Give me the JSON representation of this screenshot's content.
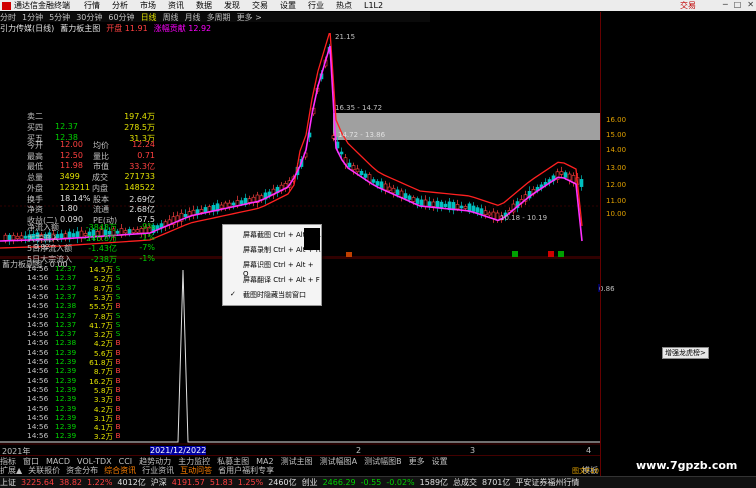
{
  "app": {
    "title": "通达信金融终端",
    "right_link": "交易"
  },
  "menu": [
    "行情",
    "分析",
    "市场",
    "资讯",
    "数据",
    "发现",
    "交易",
    "设置",
    "行业",
    "热点",
    "L1L2"
  ],
  "periods": [
    "分时",
    "1分钟",
    "5分钟",
    "30分钟",
    "60分钟",
    "日线",
    "周线",
    "月线",
    "多周期",
    "更多 >"
  ],
  "active_period": "日线",
  "info": {
    "indicator": "引力传媒(日线)",
    "label2": "蓄力板主图",
    "val1": "开盘 11.91",
    "val2": "涨幅贡献 12.92"
  },
  "chart_labels": {
    "hi": "21.15",
    "box1": "16.35 - 14.72",
    "box2": "14.72 - 13.86",
    "lo": "10.18 - 10.19",
    "left_lo": "9.02"
  },
  "price_axis": [
    "16.00",
    "15.00",
    "14.00",
    "13.00",
    "12.00",
    "11.00",
    "10.00"
  ],
  "sub_label": "蓄力板副图 : 0.00",
  "sub_value": "0.86",
  "date_axis": {
    "left": "2021年",
    "mid": "2021/12/2022",
    "m2": "2",
    "m3": "3",
    "m4": "4"
  },
  "context_menu": [
    {
      "label": "屏幕截图 Ctrl + Alt + A",
      "checked": false
    },
    {
      "label": "屏幕录制 Ctrl + Alt + R",
      "checked": false
    },
    {
      "label": "屏幕识图 Ctrl + Alt + O",
      "checked": false
    },
    {
      "label": "屏幕翻译 Ctrl + Alt + F",
      "checked": false
    },
    {
      "label": "截图时隐藏当前窗口",
      "checked": true
    }
  ],
  "toolbar": [
    "指标",
    "窗口",
    "MACD",
    "VOL-TDX",
    "CCI",
    "趋势动力",
    "主力监控",
    "私募主图",
    "MA2",
    "测试主图",
    "测试幅图A",
    "测试幅图B",
    "更多",
    "设置"
  ],
  "toolbar2": [
    "扩展▲",
    "关联报价",
    "资金分布",
    "综合资讯",
    "行业资讯",
    "互动问答",
    "省用户福利专享"
  ],
  "toolbar2_right": "模板",
  "quotes": [
    {
      "label": "卖二",
      "price": "",
      "vol": "197.4万",
      "pc": "wh"
    },
    {
      "label": "买四",
      "price": "12.37",
      "vol": "278.5万",
      "pc": "dn"
    },
    {
      "label": "买五",
      "price": "12.38",
      "vol": "31.3万",
      "pc": "dn"
    }
  ],
  "stats": [
    {
      "a": "今开",
      "b": "12.00",
      "c": "均价",
      "d": "12.24"
    },
    {
      "a": "最高",
      "b": "12.50",
      "c": "量比",
      "d": "0.71"
    },
    {
      "a": "最低",
      "b": "11.98",
      "c": "市值",
      "d": "33.3亿"
    },
    {
      "a": "总量",
      "b": "3499",
      "c": "成交",
      "d": "271733"
    },
    {
      "a": "外盘",
      "b": "123211",
      "c": "内盘",
      "d": "148522"
    },
    {
      "a": "换手",
      "b": "18.14%",
      "c": "股本",
      "d": "2.69亿"
    },
    {
      "a": "净资",
      "b": "1.80",
      "c": "流通",
      "d": "2.68亿"
    },
    {
      "a": "收益(二)",
      "b": "0.090",
      "c": "PE(动)",
      "d": "67.5"
    }
  ],
  "flows": [
    {
      "label": "净流入额",
      "v": "-3848万",
      "p": "-9%"
    },
    {
      "label": "大宗流入",
      "v": "-246.8万",
      "p": "-1%"
    },
    {
      "label": "5日净流入额",
      "v": "-1.43亿",
      "p": "-7%"
    },
    {
      "label": "5日大宗流入",
      "v": "-238万",
      "p": "-1%"
    }
  ],
  "ticks": [
    {
      "t": "14:56",
      "p": "12.37",
      "v": "14.5万",
      "f": "S"
    },
    {
      "t": "14:56",
      "p": "12.37",
      "v": "5.2万",
      "f": "S"
    },
    {
      "t": "14:56",
      "p": "12.37",
      "v": "8.7万",
      "f": "S"
    },
    {
      "t": "14:56",
      "p": "12.37",
      "v": "5.3万",
      "f": "S"
    },
    {
      "t": "14:56",
      "p": "12.38",
      "v": "55.5万",
      "f": "B"
    },
    {
      "t": "14:56",
      "p": "12.37",
      "v": "7.8万",
      "f": "S"
    },
    {
      "t": "14:56",
      "p": "12.37",
      "v": "41.7万",
      "f": "S"
    },
    {
      "t": "14:56",
      "p": "12.37",
      "v": "3.2万",
      "f": "S"
    },
    {
      "t": "14:56",
      "p": "12.38",
      "v": "4.2万",
      "f": "B"
    },
    {
      "t": "14:56",
      "p": "12.39",
      "v": "5.6万",
      "f": "B"
    },
    {
      "t": "14:56",
      "p": "12.39",
      "v": "61.8万",
      "f": "B"
    },
    {
      "t": "14:56",
      "p": "12.39",
      "v": "8.7万",
      "f": "B"
    },
    {
      "t": "14:56",
      "p": "12.39",
      "v": "16.2万",
      "f": "B"
    },
    {
      "t": "14:56",
      "p": "12.39",
      "v": "5.8万",
      "f": "B"
    },
    {
      "t": "14:56",
      "p": "12.39",
      "v": "3.3万",
      "f": "B"
    },
    {
      "t": "14:56",
      "p": "12.39",
      "v": "4.2万",
      "f": "B"
    },
    {
      "t": "14:56",
      "p": "12.39",
      "v": "3.1万",
      "f": "B"
    },
    {
      "t": "14:56",
      "p": "12.39",
      "v": "4.1万",
      "f": "B"
    },
    {
      "t": "14:56",
      "p": "12.39",
      "v": "3.2万",
      "f": "B"
    }
  ],
  "tooltip": "增强龙虎榜>",
  "status": [
    {
      "name": "上证",
      "v": "3225.64",
      "c": "38.82",
      "p": "1.22%",
      "a": "4012亿"
    },
    {
      "name": "沪深",
      "v": "4191.57",
      "c": "51.83",
      "p": "1.25%",
      "a": "2460亿"
    },
    {
      "name": "创业",
      "v": "2466.29",
      "c": "-0.55",
      "p": "-0.02%",
      "a": "1589亿"
    }
  ],
  "status_extra": {
    "total_label": "总成交",
    "total": "8701亿",
    "broker": "平安证券福州行情"
  },
  "watermark": "www.7gpzb.com",
  "sidebar_tag": "图文F10",
  "colors": {
    "up": "#ff4040",
    "down": "#00d000",
    "ma": "#ff00ff"
  }
}
